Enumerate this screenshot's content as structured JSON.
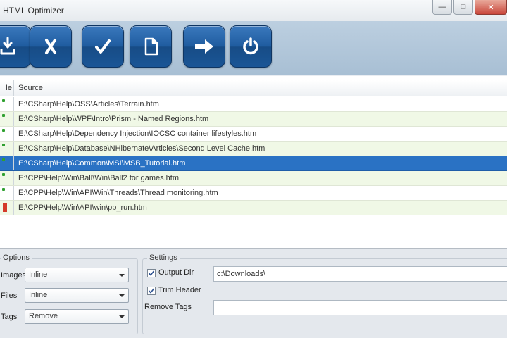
{
  "window": {
    "title": "HTML Optimizer",
    "minimize": "—",
    "maximize": "□",
    "close": "✕"
  },
  "toolbar": {
    "buttons": [
      {
        "icon": "import-icon"
      },
      {
        "icon": "remove-icon"
      },
      {
        "icon": "check-icon"
      },
      {
        "icon": "new-document-icon"
      },
      {
        "icon": "run-arrow-icon"
      },
      {
        "icon": "power-icon"
      }
    ]
  },
  "list": {
    "col_status": "Ie",
    "col_source": "Source",
    "rows": [
      {
        "status": "ok",
        "source": "E:\\CSharp\\Help\\OSS\\Articles\\Terrain.htm"
      },
      {
        "status": "ok",
        "source": "E:\\CSharp\\Help\\WPF\\Intro\\Prism - Named Regions.htm"
      },
      {
        "status": "ok",
        "source": "E:\\CSharp\\Help\\Dependency Injection\\IOCSC container lifestyles.htm"
      },
      {
        "status": "ok",
        "source": "E:\\CSharp\\Help\\Database\\NHibernate\\Articles\\Second Level Cache.htm"
      },
      {
        "status": "ok",
        "source": "E:\\CSharp\\Help\\Common\\MSI\\MSB_Tutorial.htm"
      },
      {
        "status": "ok",
        "source": "E:\\CPP\\Help\\Win\\Ball\\Win\\Ball2 for games.htm"
      },
      {
        "status": "ok",
        "source": "E:\\CPP\\Help\\Win\\API\\Win\\Threads\\Thread monitoring.htm"
      },
      {
        "status": "err",
        "source": "E:\\CPP\\Help\\Win\\API\\win\\pp_run.htm"
      }
    ],
    "selected_index": 4
  },
  "options": {
    "title": "Options",
    "fields": [
      {
        "label": "Images",
        "value": "Inline"
      },
      {
        "label": "Files",
        "value": "Inline"
      },
      {
        "label": "Tags",
        "value": "Remove"
      }
    ]
  },
  "settings": {
    "title": "Settings",
    "output_dir_label": "Output Dir",
    "output_dir_checked": true,
    "output_dir_value": "c:\\Downloads\\",
    "trim_header_label": "Trim Header",
    "trim_header_checked": true,
    "remove_tags_label": "Remove Tags",
    "remove_tags_value": ""
  },
  "colors": {
    "toolbar_button": "#1f5c9f",
    "selected_row": "#2a72c4",
    "alt_row": "#f0f8e6",
    "ok_status": "#2fa02f",
    "error_status": "#d43a2a"
  }
}
